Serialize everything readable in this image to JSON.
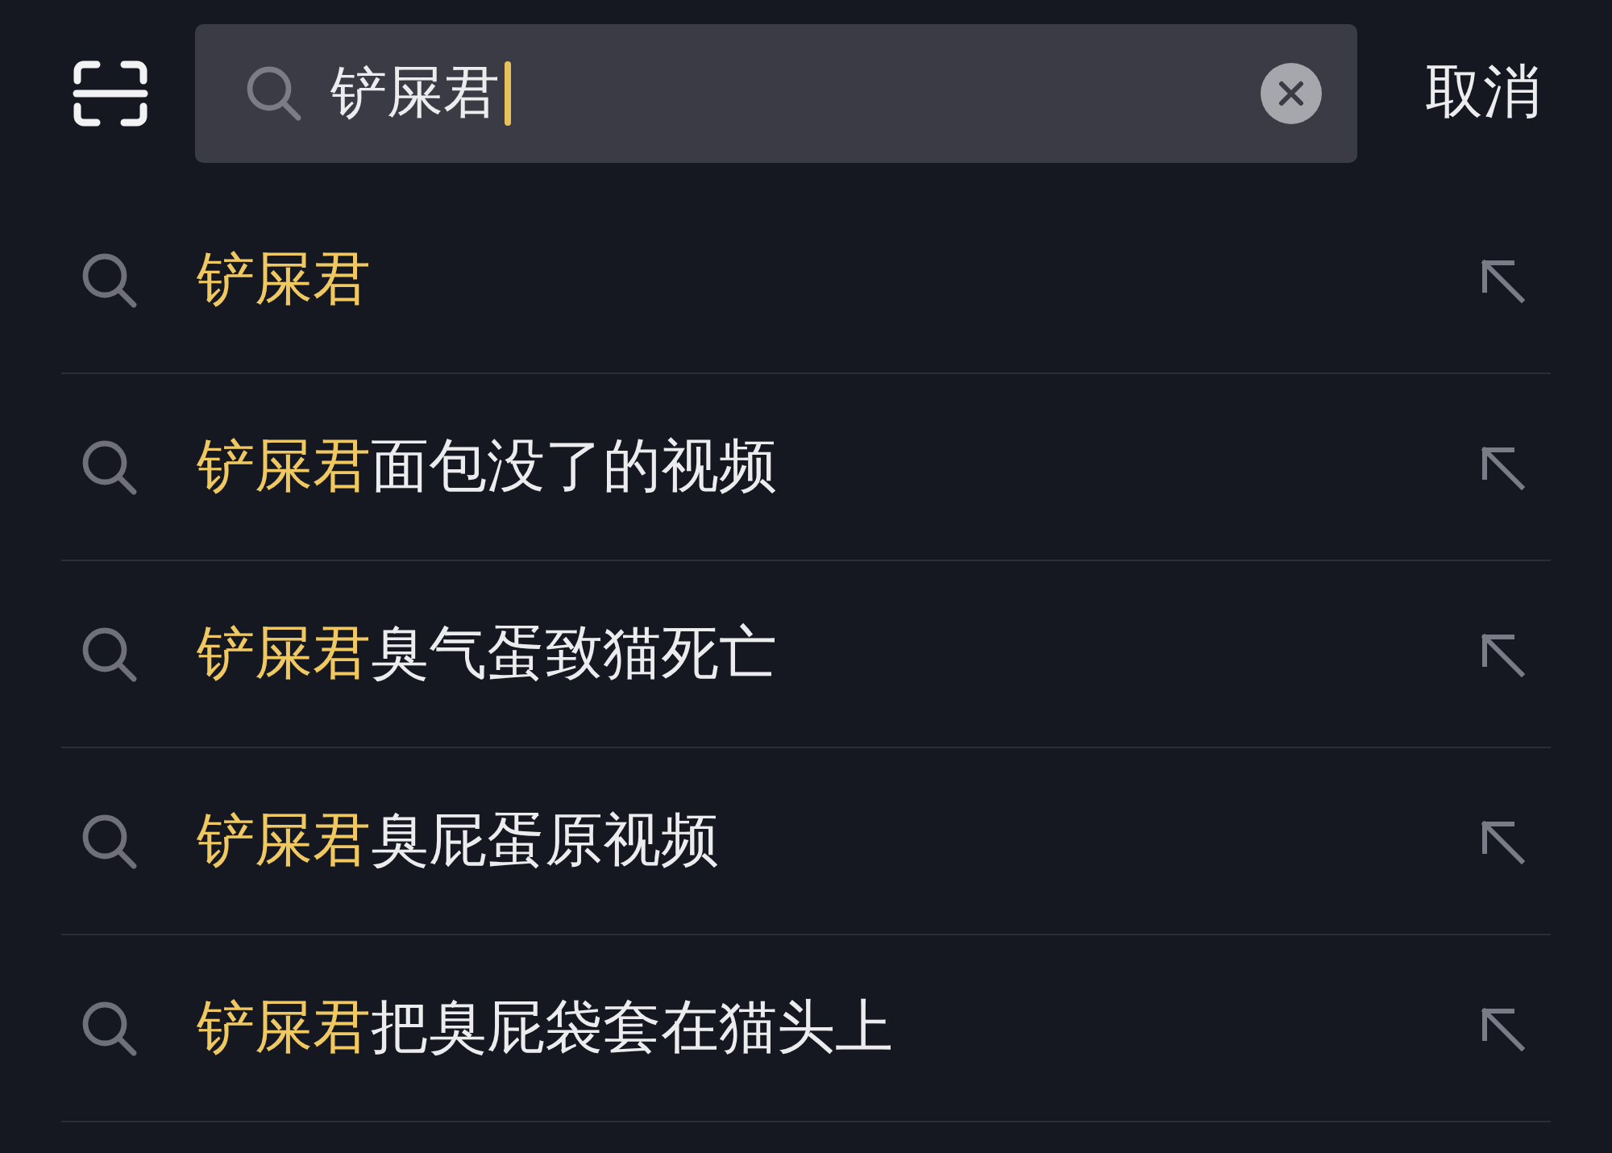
{
  "search": {
    "value": "铲屎君",
    "focused": true
  },
  "cancel_button": "取消",
  "suggestions": [
    {
      "highlight": "铲屎君"
    },
    {
      "highlight": "铲屎君",
      "rest": "面包没了的视频"
    },
    {
      "highlight": "铲屎君",
      "rest": "臭气蛋致猫死亡"
    },
    {
      "highlight": "铲屎君",
      "rest": "臭屁蛋原视频"
    },
    {
      "highlight": "铲屎君",
      "rest": "把臭屁袋套在猫头上"
    }
  ]
}
